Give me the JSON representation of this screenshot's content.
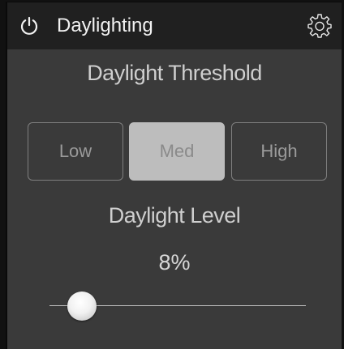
{
  "header": {
    "title": "Daylighting",
    "power_icon": "power-icon",
    "settings_icon": "gear-icon"
  },
  "threshold": {
    "title": "Daylight Threshold",
    "options": [
      "Low",
      "Med",
      "High"
    ],
    "selected": "Med"
  },
  "level": {
    "title": "Daylight Level",
    "value_text": "8%",
    "value": 8
  },
  "colors": {
    "panel_bg": "#3a3a3a",
    "header_bg": "#202020",
    "selected_button": "#bdbdbd"
  }
}
